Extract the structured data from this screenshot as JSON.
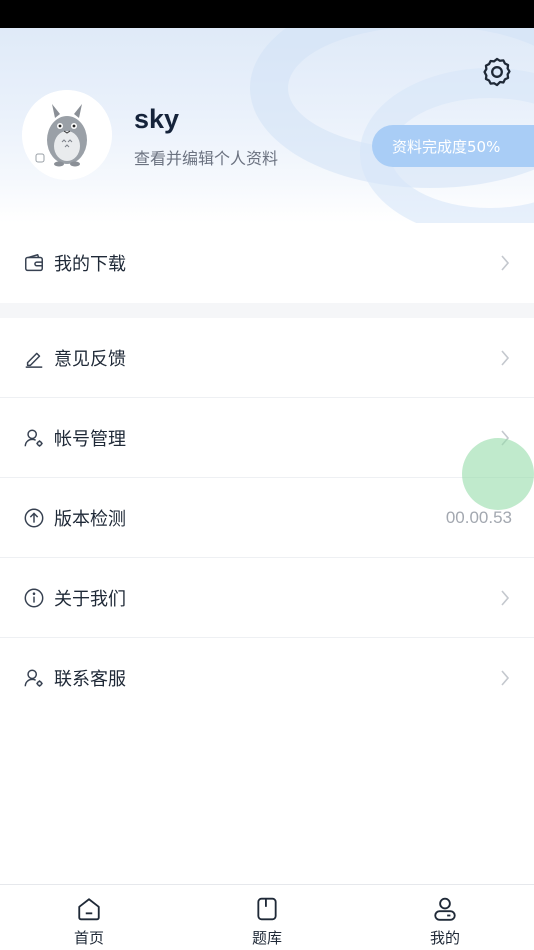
{
  "profile": {
    "username": "sky",
    "subtitle": "查看并编辑个人资料",
    "completion": "资料完成度50%",
    "completion_percent": 50
  },
  "menu": {
    "downloads": "我的下载",
    "feedback": "意见反馈",
    "account": "帐号管理",
    "version_check": "版本检测",
    "version_value": "00.00.53",
    "about": "关于我们",
    "support": "联系客服"
  },
  "tabs": {
    "home": "首页",
    "question_bank": "题库",
    "mine": "我的"
  },
  "colors": {
    "badge": "#a9cdf6",
    "accent_text": "#15233a",
    "touch": "#96dcaa"
  }
}
